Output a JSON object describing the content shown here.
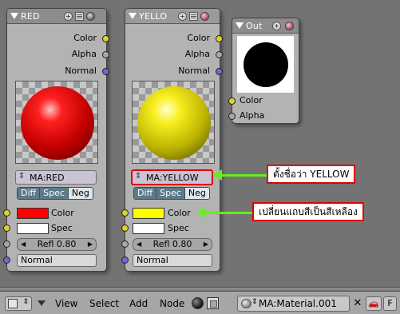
{
  "nodes": {
    "red": {
      "title": "RED",
      "outputs": [
        "Color",
        "Alpha",
        "Normal"
      ],
      "material": "MA:RED",
      "tabs": [
        "Diff",
        "Spec",
        "Neg"
      ],
      "color_label": "Color",
      "color_swatch": "#ff0000",
      "spec_label": "Spec",
      "spec_swatch": "#ffffff",
      "refl": "Refl 0.80",
      "normal": "Normal"
    },
    "yellow": {
      "title": "YELLO",
      "outputs": [
        "Color",
        "Alpha",
        "Normal"
      ],
      "material": "MA:YELLOW",
      "tabs": [
        "Diff",
        "Spec",
        "Neg"
      ],
      "color_label": "Color",
      "color_swatch": "#ffff00",
      "spec_label": "Spec",
      "spec_swatch": "#ffffff",
      "refl": "Refl 0.80",
      "normal": "Normal"
    },
    "out": {
      "title": "Out",
      "inputs": [
        "Color",
        "Alpha"
      ]
    }
  },
  "annotations": {
    "rename": "ตั้งชื่อว่า YELLOW",
    "recolor": "เปลี่ยนแถบสีเป็นสีเหลือง",
    "arrow_color": "#66ee22"
  },
  "bottom_bar": {
    "menus": [
      "View",
      "Select",
      "Add",
      "Node"
    ],
    "material_field": "MA:Material.001",
    "close": "✕",
    "fake_user": "F"
  }
}
